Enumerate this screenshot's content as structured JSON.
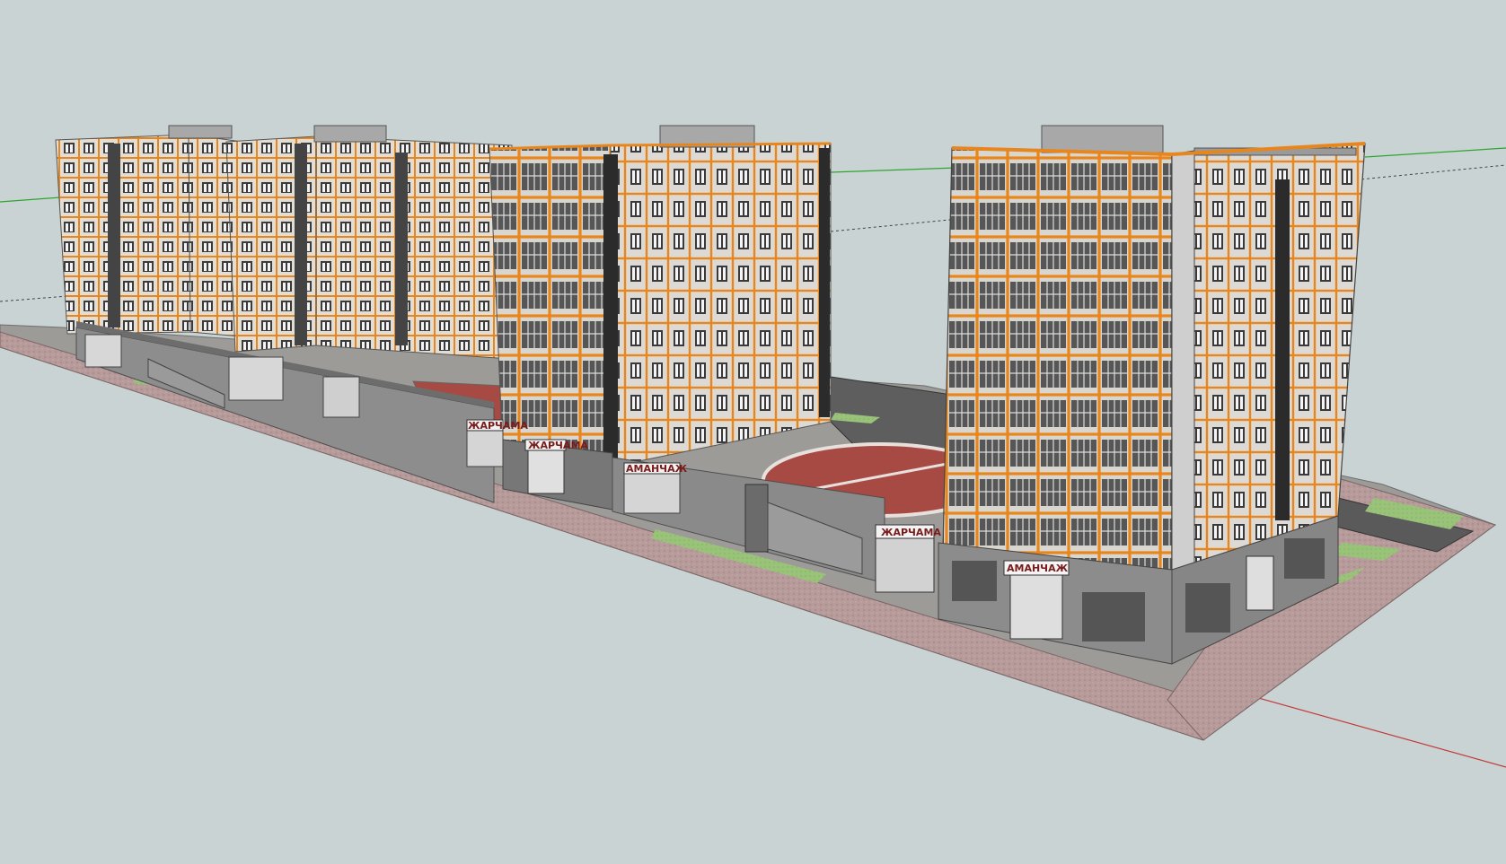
{
  "scene": {
    "background_color": "#c9d3d4",
    "axis_colors": {
      "green_axis": "#2fa52f",
      "red_axis": "#c43a3a",
      "dashed_axis": "#444444"
    },
    "facade_accent": "#e8861e",
    "signs": {
      "sign_a": "ЖАРЧАМА",
      "sign_b": "АМАНЧАЖ",
      "sign_c": "ЖАРЧАМА",
      "sign_d": "АМАНЧАЖ",
      "sign_e": "ЖАРЧАМА"
    }
  }
}
